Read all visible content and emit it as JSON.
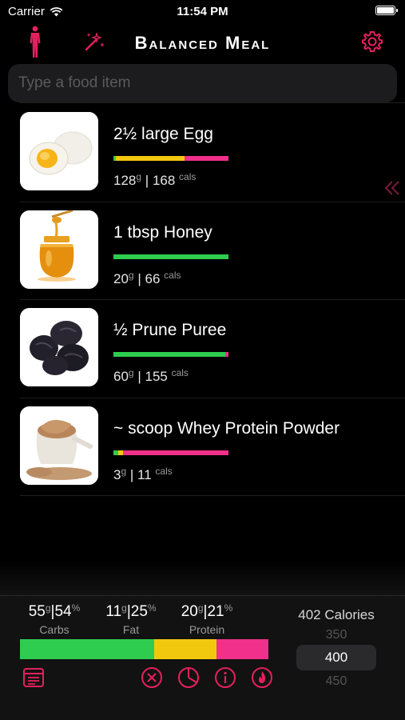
{
  "status_bar": {
    "carrier": "Carrier",
    "time": "11:54 PM"
  },
  "nav": {
    "title": "Balanced Meal"
  },
  "search": {
    "placeholder": "Type a food item",
    "value": ""
  },
  "colors": {
    "accent": "#e5205f",
    "carbs": "#2ecc4f",
    "fat": "#f2c80f",
    "protein": "#f0308a"
  },
  "food_items": [
    {
      "name": "2½ large Egg",
      "grams": "128",
      "grams_unit": "g",
      "calories": "168",
      "cal_unit": "cals",
      "image": "boiled-egg",
      "macros": {
        "carbs": 0.02,
        "fat": 0.6,
        "protein": 0.38
      }
    },
    {
      "name": "1 tbsp Honey",
      "grams": "20",
      "grams_unit": "g",
      "calories": "66",
      "cal_unit": "cals",
      "image": "honey-jar",
      "macros": {
        "carbs": 1.0,
        "fat": 0,
        "protein": 0
      }
    },
    {
      "name": "½ Prune Puree",
      "grams": "60",
      "grams_unit": "g",
      "calories": "155",
      "cal_unit": "cals",
      "image": "prunes",
      "macros": {
        "carbs": 0.97,
        "fat": 0,
        "protein": 0.03
      }
    },
    {
      "name": "~ scoop Whey Protein Powder",
      "grams": "3",
      "grams_unit": "g",
      "calories": "11",
      "cal_unit": "cals",
      "image": "protein-powder",
      "macros": {
        "carbs": 0.04,
        "fat": 0.04,
        "protein": 0.92
      }
    }
  ],
  "summary": {
    "carbs": {
      "grams": "55",
      "grams_unit": "g",
      "sep": "|",
      "pct": "54",
      "pct_unit": "%",
      "label": "Carbs"
    },
    "fat": {
      "grams": "11",
      "grams_unit": "g",
      "sep": "|",
      "pct": "25",
      "pct_unit": "%",
      "label": "Fat"
    },
    "protein": {
      "grams": "20",
      "grams_unit": "g",
      "sep": "|",
      "pct": "21",
      "pct_unit": "%",
      "label": "Protein"
    },
    "bar": {
      "carbs": 0.54,
      "fat": 0.25,
      "protein": 0.21
    }
  },
  "calories": {
    "total_label": "402 Calories",
    "options": [
      "350",
      "400",
      "450"
    ],
    "selected": "400"
  },
  "footer_icons": [
    "notes-icon",
    "clear-icon",
    "pie-chart-icon",
    "info-icon",
    "flame-icon"
  ]
}
